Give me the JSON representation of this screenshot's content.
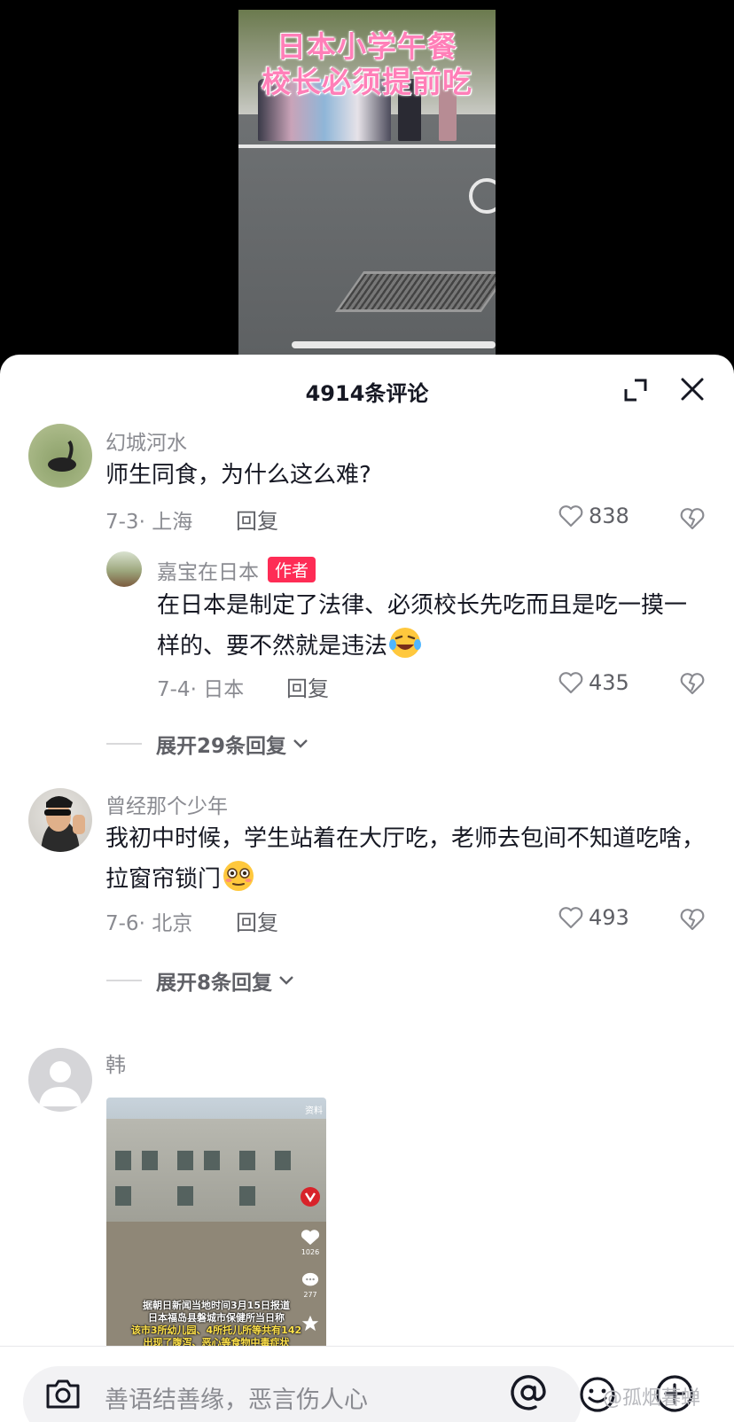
{
  "video": {
    "title_line1": "日本小学午餐",
    "title_line2": "校长必须提前吃"
  },
  "panel": {
    "title": "4914条评论"
  },
  "comments": [
    {
      "user": "幻城河水",
      "text": "师生同食，为什么这么难?",
      "date": "7-3",
      "location": "上海",
      "reply_label": "回复",
      "likes": "838"
    },
    {
      "user": "嘉宝在日本",
      "badge": "作者",
      "text": "在日本是制定了法律、必须校长先吃而且是吃一摸一样的、要不然就是违法",
      "date": "7-4",
      "location": "日本",
      "reply_label": "回复",
      "likes": "435"
    },
    {
      "user": "曾经那个少年",
      "text": "我初中时候，学生站着在大厅吃，老师去包间不知道吃啥，拉窗帘锁门",
      "date": "7-6",
      "location": "北京",
      "reply_label": "回复",
      "likes": "493"
    },
    {
      "user": "韩"
    }
  ],
  "expand": [
    {
      "label": "展开29条回复"
    },
    {
      "label": "展开8条回复"
    }
  ],
  "thumbnail": {
    "corner_label": "资料",
    "side_count_1": "1026",
    "side_count_2": "277",
    "caption_line1": "据朝日新闻当地时间3月15日报道",
    "caption_line2": "日本福岛县磐城市保健所当日称",
    "caption_line3": "该市3所幼儿园、4所托儿所等共有142",
    "caption_line4": "出现了腹泻、恶心等食物中毒症状"
  },
  "input": {
    "placeholder": "善语结善缘，恶言伤人心",
    "watermark": "@孤烟暮蝉"
  },
  "colors": {
    "accent": "#fe2c55",
    "title_pink": "#ff7fb8"
  }
}
